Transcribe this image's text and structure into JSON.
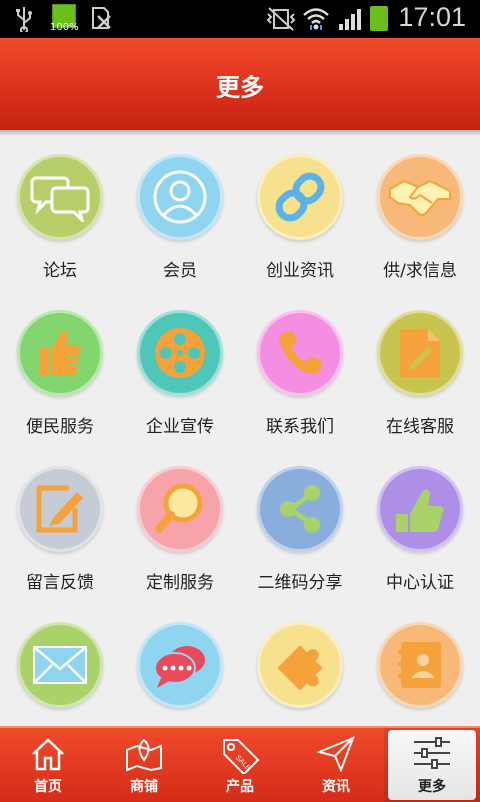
{
  "status_bar": {
    "time": "17:01",
    "battery_percent": "100%"
  },
  "header": {
    "title": "更多"
  },
  "grid": {
    "items": [
      {
        "label": "论坛",
        "icon": "chat-bubbles-icon",
        "color": "#b7cf6a"
      },
      {
        "label": "会员",
        "icon": "user-icon",
        "color": "#8fd5ef"
      },
      {
        "label": "创业资讯",
        "icon": "link-icon",
        "color": "#f7e08e"
      },
      {
        "label": "供/求信息",
        "icon": "handshake-icon",
        "color": "#f8b879"
      },
      {
        "label": "便民服务",
        "icon": "thumbs-up-icon",
        "color": "#83d56d"
      },
      {
        "label": "企业宣传",
        "icon": "film-reel-icon",
        "color": "#4fc7b8"
      },
      {
        "label": "联系我们",
        "icon": "phone-icon",
        "color": "#f58ee2"
      },
      {
        "label": "在线客服",
        "icon": "document-edit-icon",
        "color": "#c7c54f"
      },
      {
        "label": "留言反馈",
        "icon": "edit-icon",
        "color": "#c5ccd6"
      },
      {
        "label": "定制服务",
        "icon": "magnifier-icon",
        "color": "#f6a3aa"
      },
      {
        "label": "二维码分享",
        "icon": "share-icon",
        "color": "#89aede"
      },
      {
        "label": "中心认证",
        "icon": "thumbs-up-icon",
        "color": "#ad8fe8"
      },
      {
        "label": "",
        "icon": "mail-icon",
        "color": "#a9d26a"
      },
      {
        "label": "",
        "icon": "speech-bubble-icon",
        "color": "#8fd5ef"
      },
      {
        "label": "",
        "icon": "puzzle-icon",
        "color": "#f7e08e"
      },
      {
        "label": "",
        "icon": "contacts-icon",
        "color": "#f8b879"
      }
    ]
  },
  "tab_bar": {
    "tabs": [
      {
        "label": "首页",
        "icon": "home-icon"
      },
      {
        "label": "商铺",
        "icon": "map-icon"
      },
      {
        "label": "产品",
        "icon": "sale-tag-icon"
      },
      {
        "label": "资讯",
        "icon": "send-icon"
      },
      {
        "label": "更多",
        "icon": "settings-sliders-icon",
        "active": true
      }
    ]
  },
  "colors": {
    "header_red": "#d9301b",
    "icon_orange": "#f5a23a",
    "background": "#efefef"
  }
}
